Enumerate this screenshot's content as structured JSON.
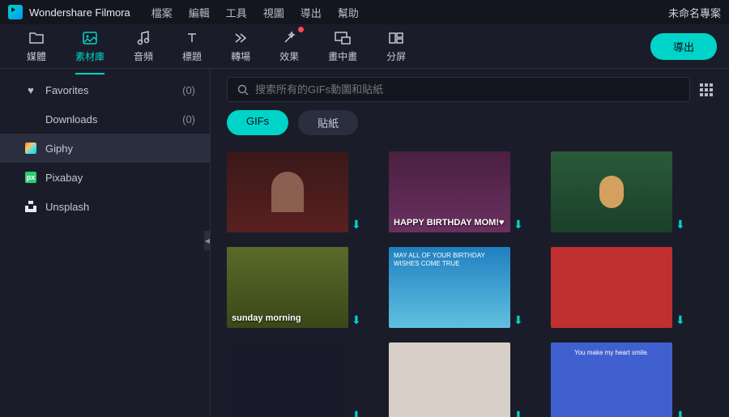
{
  "app": {
    "title": "Wondershare Filmora",
    "project": "未命名專案"
  },
  "menu": [
    "檔案",
    "編輯",
    "工具",
    "視圖",
    "導出",
    "幫助"
  ],
  "tools": [
    {
      "label": "媒體",
      "icon": "folder-icon"
    },
    {
      "label": "素材庫",
      "icon": "image-icon",
      "active": true
    },
    {
      "label": "音頻",
      "icon": "music-icon"
    },
    {
      "label": "標題",
      "icon": "text-icon"
    },
    {
      "label": "轉場",
      "icon": "transition-icon"
    },
    {
      "label": "效果",
      "icon": "wand-icon",
      "badge": true
    },
    {
      "label": "畫中畫",
      "icon": "pip-icon"
    },
    {
      "label": "分屏",
      "icon": "split-icon"
    }
  ],
  "export_label": "導出",
  "sidebar": {
    "items": [
      {
        "label": "Favorites",
        "count": "(0)",
        "icon": "heart"
      },
      {
        "label": "Downloads",
        "count": "(0)",
        "icon": ""
      },
      {
        "label": "Giphy",
        "icon": "giphy",
        "selected": true
      },
      {
        "label": "Pixabay",
        "icon": "pixabay"
      },
      {
        "label": "Unsplash",
        "icon": "unsplash"
      }
    ]
  },
  "search": {
    "placeholder": "搜索所有的GIFs動圖和貼紙"
  },
  "filters": [
    {
      "label": "GIFs",
      "active": true
    },
    {
      "label": "貼紙",
      "active": false
    }
  ],
  "thumbs": [
    {
      "overlay": ""
    },
    {
      "overlay": "HAPPY BIRTHDAY MOM!♥",
      "pos": "br"
    },
    {
      "overlay": ""
    },
    {
      "overlay": "sunday morning",
      "pos": "bl"
    },
    {
      "overlay": "MAY ALL OF YOUR BIRTHDAY WISHES COME TRUE",
      "pos": "tl"
    },
    {
      "overlay": ""
    },
    {
      "overlay": ""
    },
    {
      "overlay": ""
    },
    {
      "overlay": "You make my heart smile.",
      "pos": "tc"
    }
  ]
}
